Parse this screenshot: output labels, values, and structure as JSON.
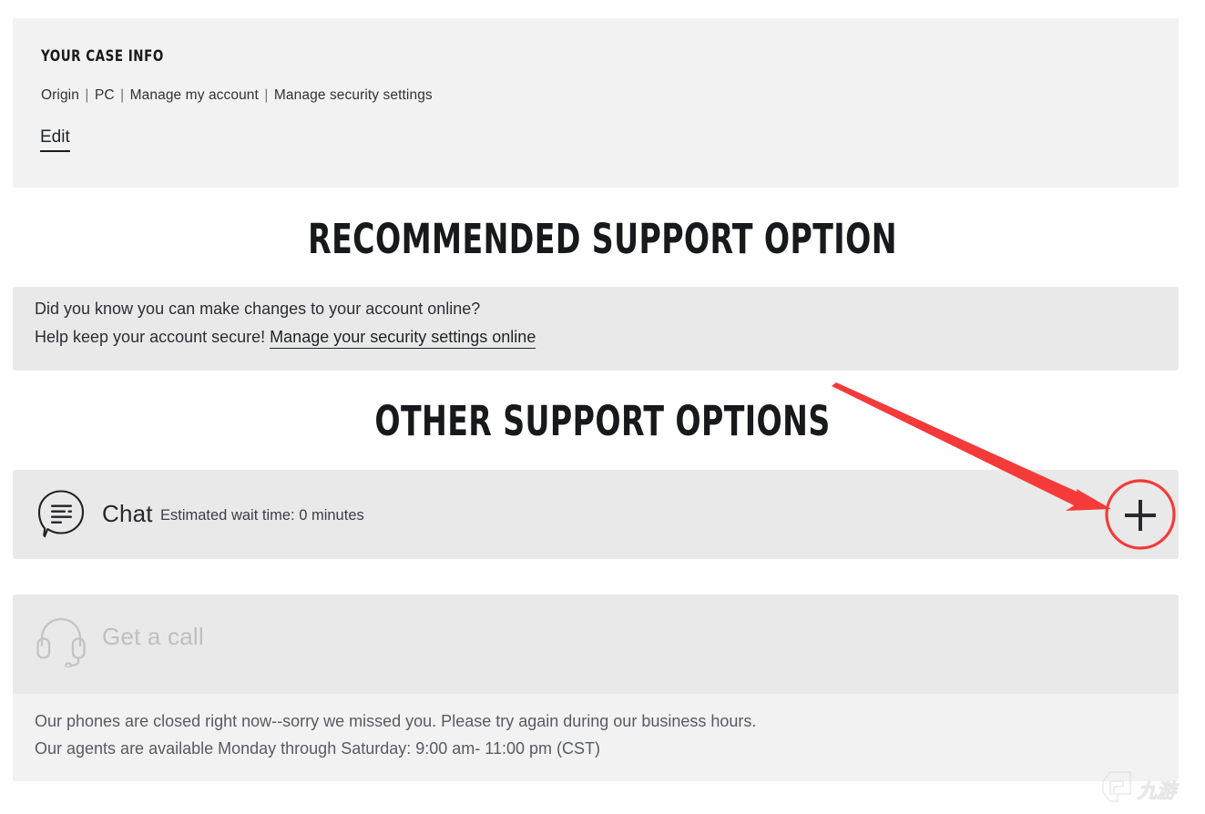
{
  "case_info": {
    "title": "YOUR CASE INFO",
    "meta": {
      "product": "Origin",
      "platform": "PC",
      "category": "Manage my account",
      "topic": "Manage security settings",
      "separator": "|"
    },
    "edit_label": "Edit"
  },
  "headings": {
    "recommended": "RECOMMENDED SUPPORT OPTION",
    "other": "OTHER SUPPORT OPTIONS"
  },
  "recommended": {
    "line1": "Did you know you can make changes to your account online?",
    "line2_prefix": "Help keep your account secure!",
    "link_text": "Manage your security settings online"
  },
  "other_options": {
    "chat": {
      "label": "Chat",
      "wait_time": "Estimated wait time: 0 minutes",
      "icon": "chat-bubble-icon",
      "expand_icon": "plus-icon"
    },
    "call": {
      "label": "Get a call",
      "icon": "headset-icon",
      "disabled": true
    },
    "hours": {
      "line1": "Our phones are closed right now--sorry we missed you. Please try again during our business hours.",
      "line2": "Our agents are available Monday through Saturday: 9:00 am- 11:00 pm (CST)"
    }
  },
  "annotation": {
    "color": "#f53a3a",
    "arrow_icon": "red-arrow-icon",
    "highlight_icon": "red-circle-highlight-icon"
  },
  "watermark": {
    "text": "九游",
    "icon": "watermark-logo-icon"
  },
  "colors": {
    "panel_light": "#f2f2f2",
    "panel_grey": "#e9e9e9",
    "text_dark": "#24282d",
    "text_muted": "#565c64",
    "disabled": "#bfbfbf",
    "accent_red": "#f53a3a"
  }
}
